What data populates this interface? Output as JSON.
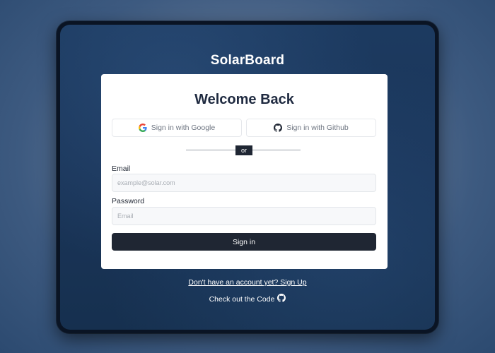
{
  "app": {
    "brand": "SolarBoard"
  },
  "card": {
    "heading": "Welcome Back",
    "google_button": "Sign in with Google",
    "github_button": "Sign in with Github",
    "divider_text": "or",
    "email_label": "Email",
    "email_placeholder": "example@solar.com",
    "password_label": "Password",
    "password_placeholder": "Email",
    "submit_button": "Sign in"
  },
  "footer": {
    "signup_link": "Don't have an account yet? Sign Up",
    "code_link": "Check out the Code"
  },
  "icons": {
    "google": "google-icon",
    "github": "github-icon"
  },
  "colors": {
    "primary_button": "#1f2633",
    "background": "#1c3a60",
    "card": "#ffffff"
  }
}
